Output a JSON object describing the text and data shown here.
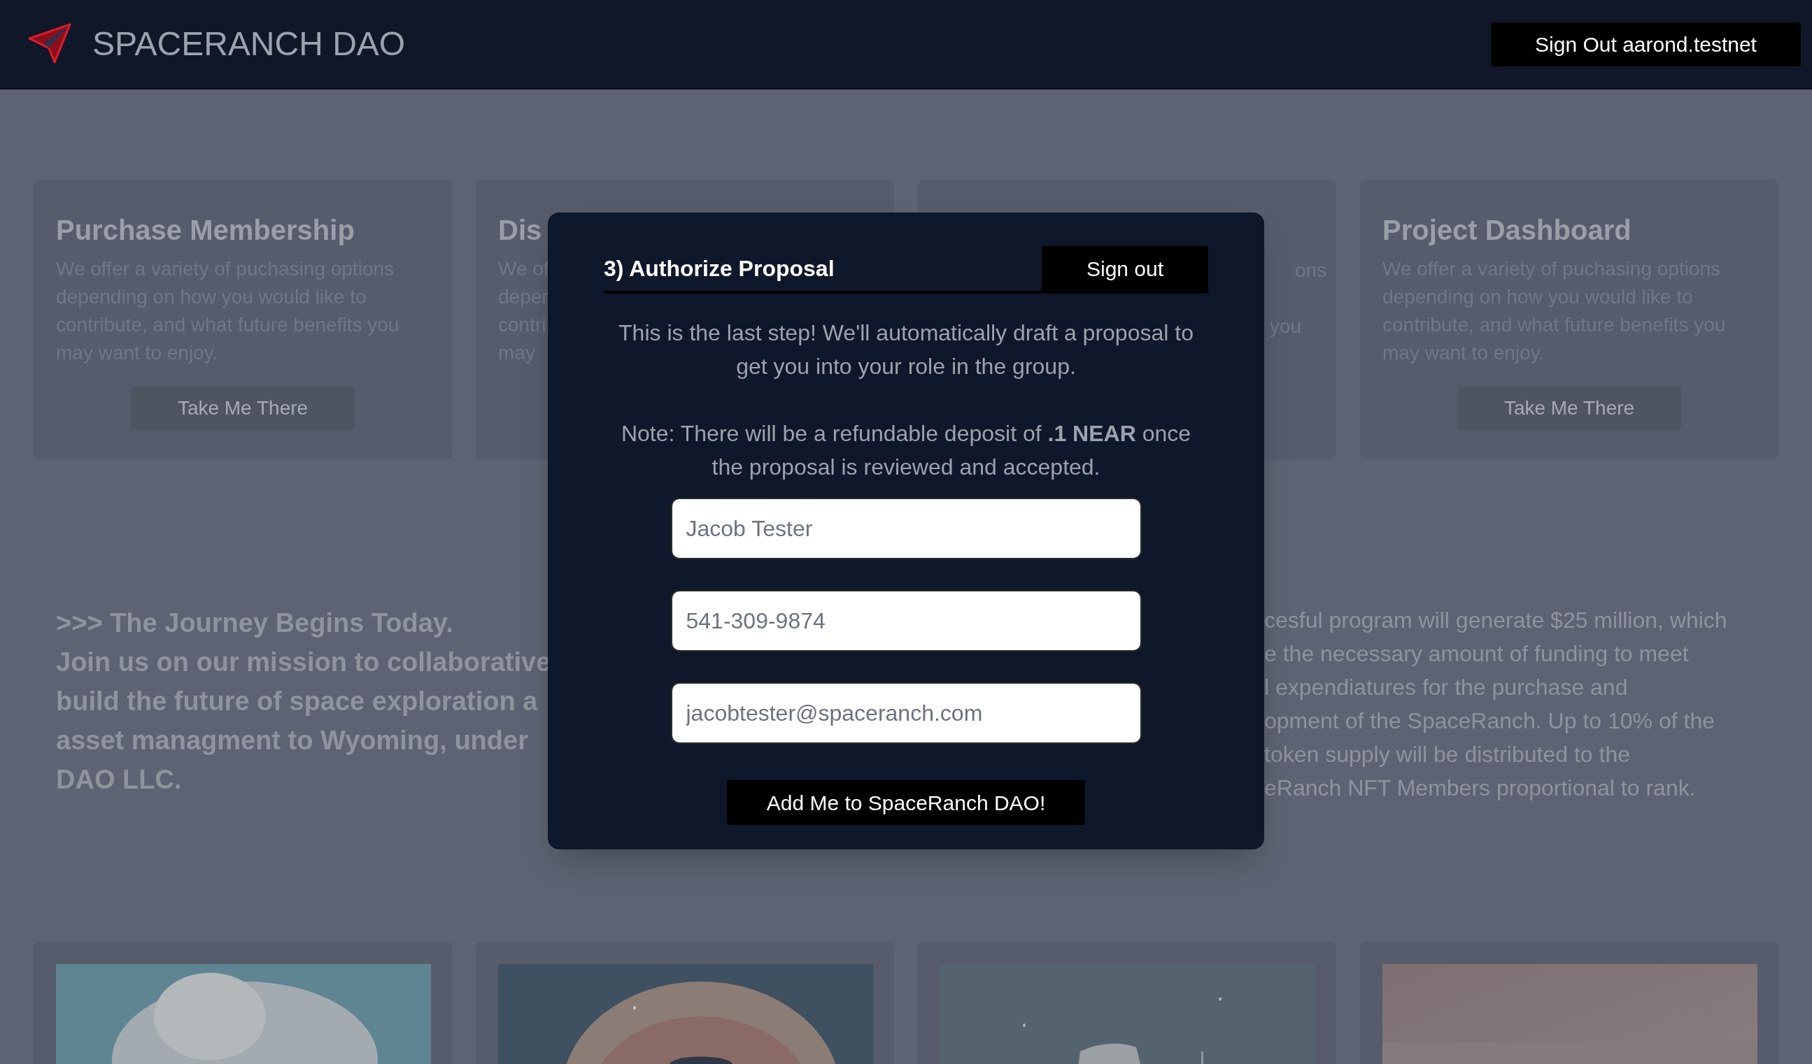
{
  "header": {
    "title": "SPACERANCH DAO",
    "sign_out_button": "Sign Out aarond.testnet"
  },
  "cards": [
    {
      "kind": "full",
      "title": "Purchase Membership",
      "lines": [
        "We offer a variety of puchasing options",
        "depending on how you would like to",
        "contribute, and what future benefits you",
        "may want to enjoy."
      ],
      "button": "Take Me There"
    },
    {
      "kind": "covered_left",
      "title": "Dis",
      "lines": [
        "We of",
        "deper",
        "contri",
        "may"
      ]
    },
    {
      "kind": "covered_right",
      "lines": [
        "ons",
        "you"
      ]
    },
    {
      "kind": "full",
      "title": "Project Dashboard",
      "lines": [
        "We offer a variety of puchasing options",
        "depending on how you would like to",
        "contribute, and what future benefits you",
        "may want to enjoy."
      ],
      "button": "Take Me There"
    }
  ],
  "journey": {
    "left_lines": [
      ">>> The Journey Begins Today.",
      "Join us on our mission to collaborative",
      "build the future of space exploration a",
      "asset managment to Wyoming, under",
      "DAO LLC."
    ],
    "right_lines": [
      "cesful program will generate $25 million, which",
      "e the necessary amount of funding to meet",
      "l expendiatures for the purchase and",
      "opment of the SpaceRanch. Up to 10% of the",
      "token supply will be distributed to the",
      "eRanch NFT Members proportional to rank."
    ]
  },
  "modal": {
    "title": "3) Authorize Proposal",
    "sign_out_button": "Sign out",
    "paragraphs": [
      "This is the last step! We'll automatically draft a proposal to get you into your role in the group.",
      "Note: There will be a refundable deposit of **.1 NEAR** once the proposal is reviewed and accepted."
    ],
    "fields": [
      {
        "value": "Jacob Tester"
      },
      {
        "value": "541-309-9874"
      },
      {
        "value": "jacobtester@spaceranch.com"
      }
    ],
    "submit_button": "Add Me to SpaceRanch DAO!"
  }
}
